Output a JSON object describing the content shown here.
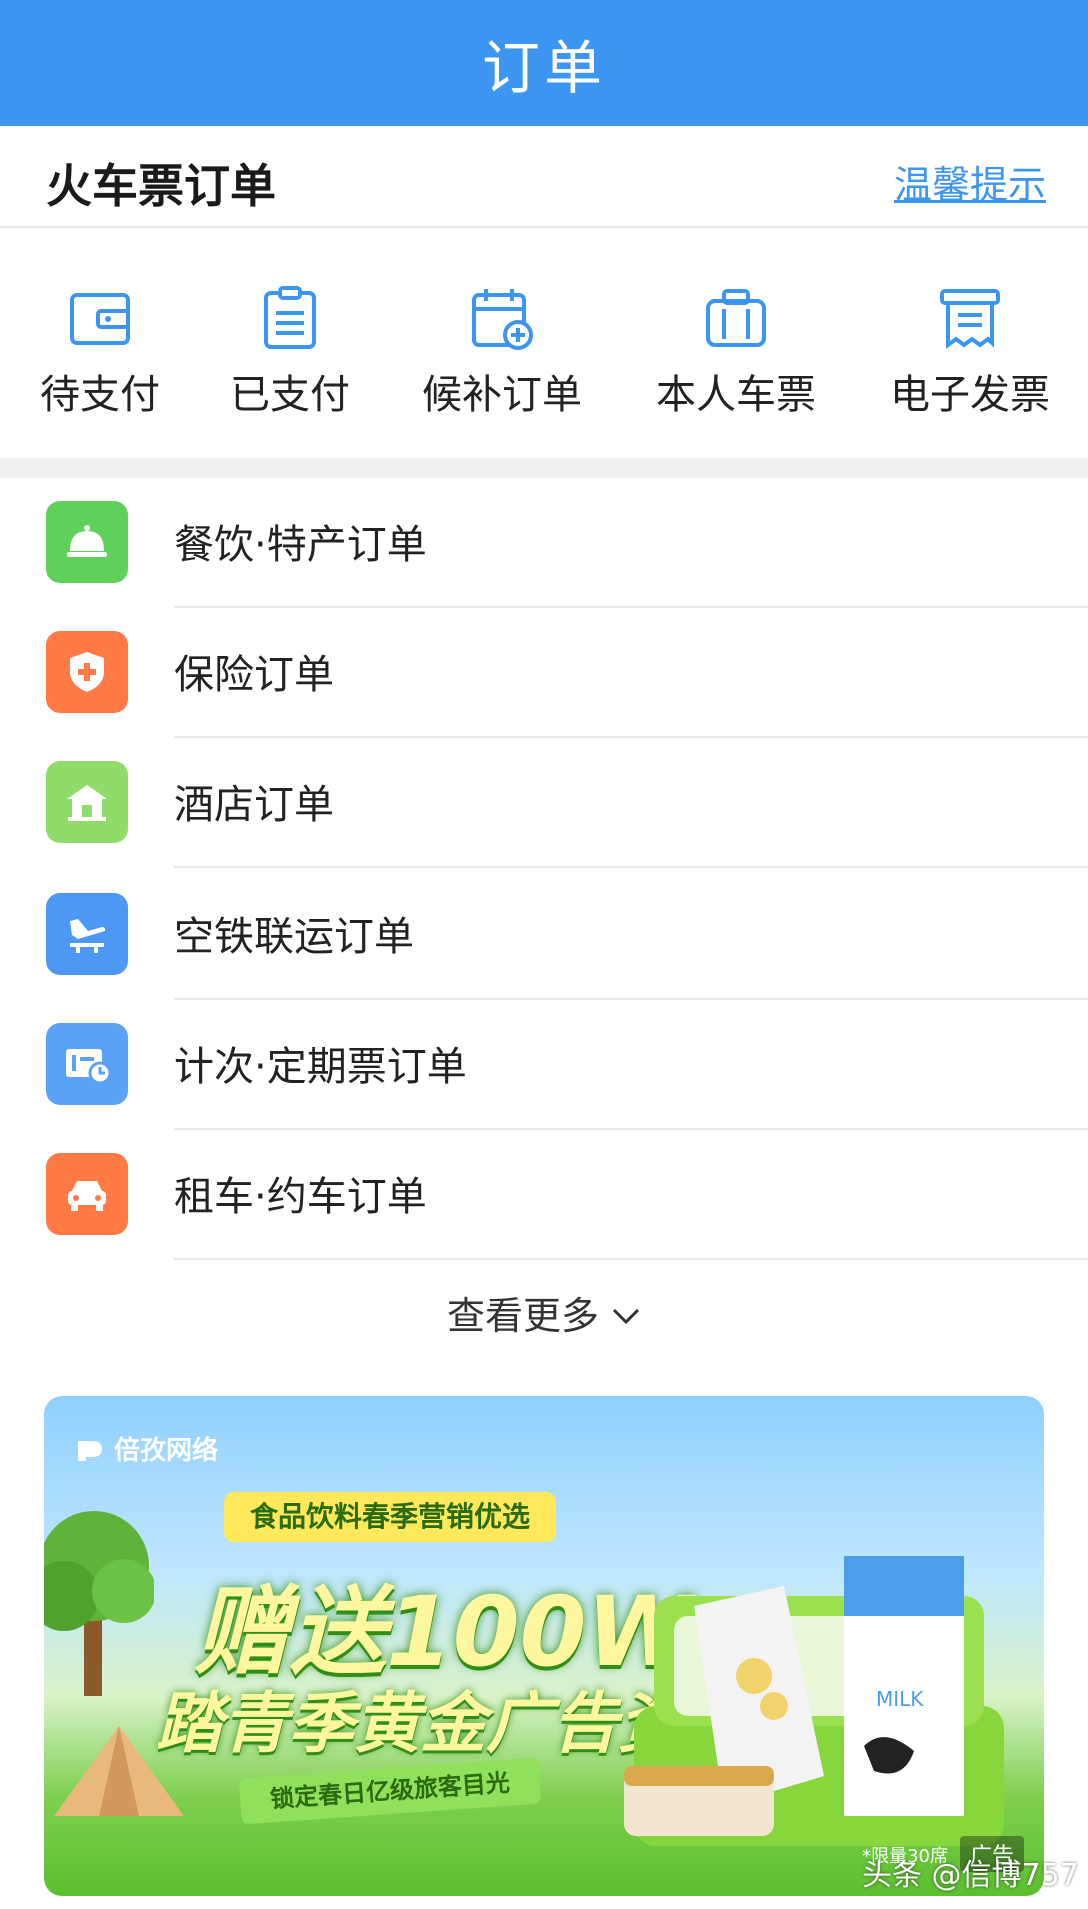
{
  "header": {
    "title": "订单"
  },
  "section": {
    "title": "火车票订单",
    "tip_link": "温馨提示"
  },
  "quick_actions": [
    {
      "label": "待支付",
      "icon": "wallet-icon"
    },
    {
      "label": "已支付",
      "icon": "clipboard-icon"
    },
    {
      "label": "候补订单",
      "icon": "calendar-add-icon"
    },
    {
      "label": "本人车票",
      "icon": "suitcase-icon"
    },
    {
      "label": "电子发票",
      "icon": "invoice-icon"
    }
  ],
  "orders": [
    {
      "label": "餐饮·特产订单",
      "icon": "bell-icon",
      "color": "#5fd05a"
    },
    {
      "label": "保险订单",
      "icon": "shield-icon",
      "color": "#ff7a45"
    },
    {
      "label": "酒店订单",
      "icon": "hotel-icon",
      "color": "#8fdc6a"
    },
    {
      "label": "空铁联运订单",
      "icon": "plane-rail-icon",
      "color": "#4e98f5"
    },
    {
      "label": "计次·定期票订单",
      "icon": "ticket-clock-icon",
      "color": "#5aa2f7"
    },
    {
      "label": "租车·约车订单",
      "icon": "car-icon",
      "color": "#ff7a45"
    }
  ],
  "more": {
    "label": "查看更多"
  },
  "ad": {
    "brand": "倍孜网络",
    "pill": "食品饮料春季营销优选",
    "headline": "赠送100W",
    "subheadline": "踏青季黄金广告资源",
    "ribbon": "锁定春日亿级旅客目光",
    "carton_label": "MILK",
    "limit_note": "*限量30席",
    "tag": "广告"
  },
  "watermark": "头条 @信博757",
  "colors": {
    "primary": "#3d95f2"
  }
}
